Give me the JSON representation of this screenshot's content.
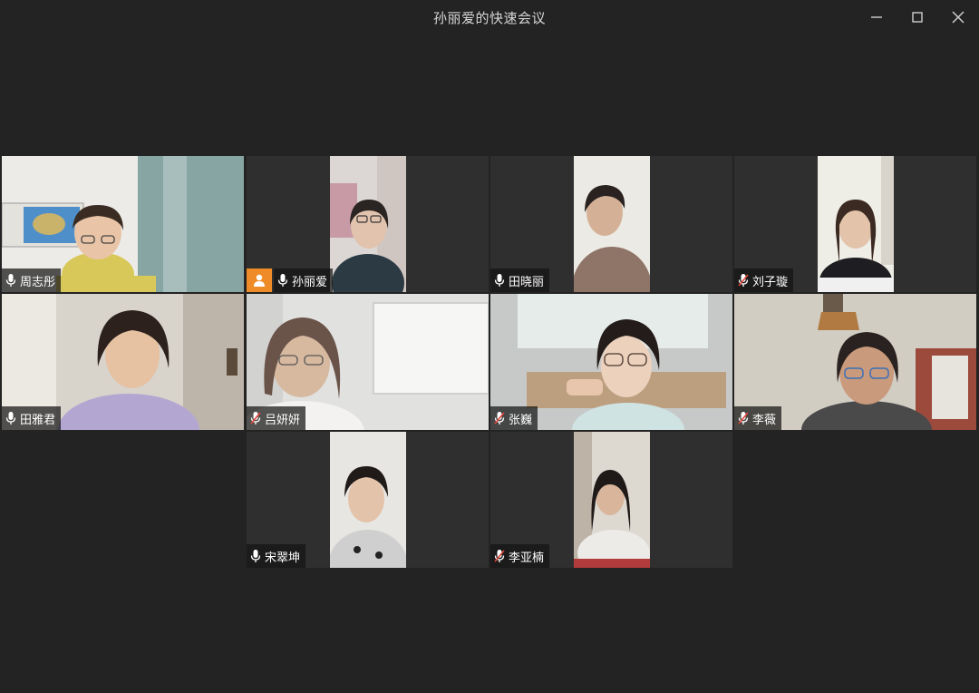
{
  "window": {
    "title": "孙丽爱的快速会议",
    "controls": {
      "minimize_icon": "minimize-icon",
      "maximize_icon": "maximize-icon",
      "close_icon": "close-icon"
    }
  },
  "participants": [
    {
      "name": "周志彤",
      "mic": "on",
      "active_speaker": true,
      "host": false
    },
    {
      "name": "孙丽爱",
      "mic": "on",
      "active_speaker": false,
      "host": true
    },
    {
      "name": "田晓丽",
      "mic": "on",
      "active_speaker": false,
      "host": false
    },
    {
      "name": "刘子璇",
      "mic": "muted",
      "active_speaker": false,
      "host": false
    },
    {
      "name": "田雅君",
      "mic": "on",
      "active_speaker": false,
      "host": false
    },
    {
      "name": "吕妍妍",
      "mic": "muted",
      "active_speaker": false,
      "host": false
    },
    {
      "name": "张巍",
      "mic": "muted",
      "active_speaker": false,
      "host": false
    },
    {
      "name": "李薇",
      "mic": "muted",
      "active_speaker": false,
      "host": false
    },
    {
      "name": "宋翠坤",
      "mic": "on",
      "active_speaker": false,
      "host": false
    },
    {
      "name": "李亚楠",
      "mic": "muted",
      "active_speaker": false,
      "host": false
    }
  ],
  "colors": {
    "background": "#232323",
    "tile_background": "#2f2f2f",
    "active_speaker_border": "#2fb36a",
    "host_badge": "#f08c28",
    "muted_slash": "#e0443a"
  }
}
